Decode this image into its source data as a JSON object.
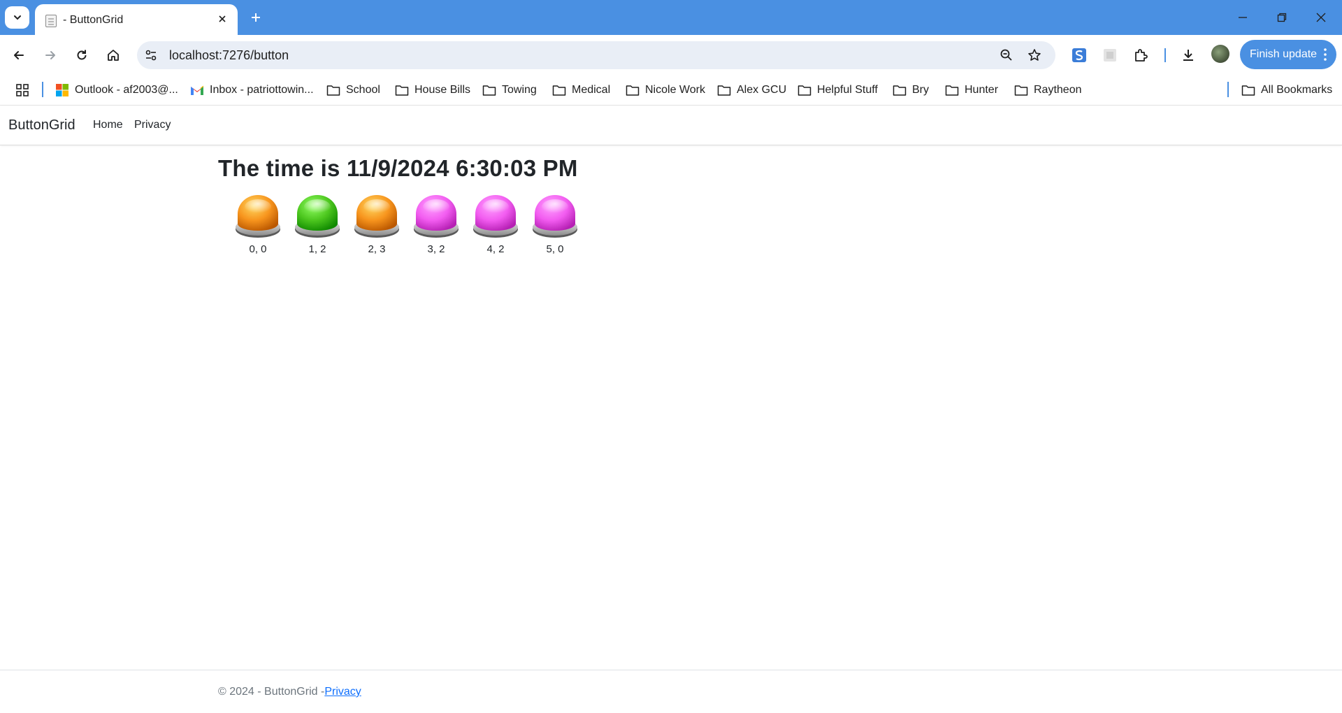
{
  "browser": {
    "tab": {
      "title": "- ButtonGrid"
    },
    "address_bar": {
      "url": "localhost:7276/button"
    },
    "finish_update_label": "Finish update",
    "bookmarks": [
      {
        "label": "Outlook - af2003@...",
        "icon": "microsoft-icon"
      },
      {
        "label": "Inbox - patriottowin...",
        "icon": "gmail-icon"
      },
      {
        "label": "School",
        "icon": "folder-icon"
      },
      {
        "label": "House Bills",
        "icon": "folder-icon"
      },
      {
        "label": "Towing",
        "icon": "folder-icon"
      },
      {
        "label": "Medical",
        "icon": "folder-icon"
      },
      {
        "label": "Nicole Work",
        "icon": "folder-icon"
      },
      {
        "label": "Alex GCU",
        "icon": "folder-icon"
      },
      {
        "label": "Helpful Stuff",
        "icon": "folder-icon"
      },
      {
        "label": "Bry",
        "icon": "folder-icon"
      },
      {
        "label": "Hunter",
        "icon": "folder-icon"
      },
      {
        "label": "Raytheon",
        "icon": "folder-icon"
      }
    ],
    "all_bookmarks_label": "All Bookmarks",
    "colors": {
      "chrome_blue": "#4a90e2",
      "omnibox_bg": "#e9eef6"
    }
  },
  "site": {
    "brand": "ButtonGrid",
    "nav": {
      "home": "Home",
      "privacy": "Privacy"
    },
    "heading": "The time is 11/9/2024 6:30:03 PM",
    "buttons": [
      {
        "label": "0, 0",
        "color": "orange"
      },
      {
        "label": "1, 2",
        "color": "green"
      },
      {
        "label": "2, 3",
        "color": "orange"
      },
      {
        "label": "3, 2",
        "color": "pink"
      },
      {
        "label": "4, 2",
        "color": "pink"
      },
      {
        "label": "5, 0",
        "color": "pink"
      }
    ],
    "button_colors": {
      "orange": "#f7941d",
      "green": "#4cc61e",
      "pink": "#f25cf0"
    },
    "footer": {
      "text": "© 2024 - ButtonGrid -",
      "link": "Privacy"
    }
  }
}
